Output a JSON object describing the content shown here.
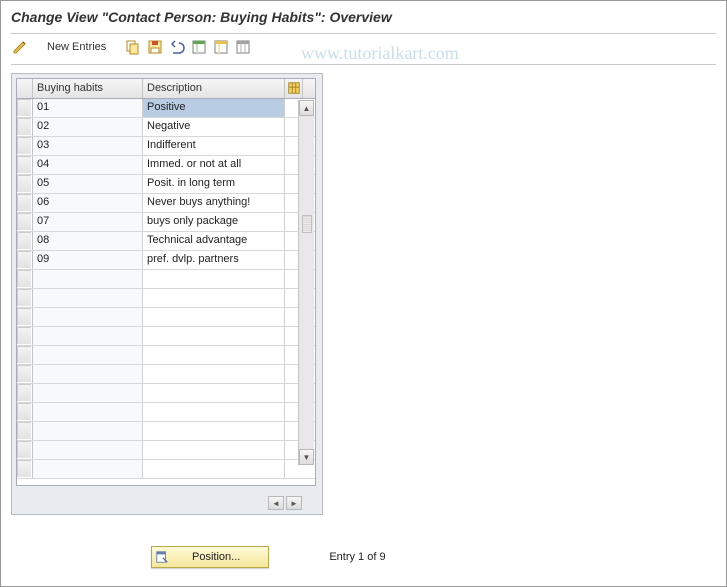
{
  "title": "Change View \"Contact Person: Buying Habits\": Overview",
  "toolbar": {
    "newEntries": "New Entries"
  },
  "watermark": "www.tutorialkart.com",
  "table": {
    "headers": {
      "code": "Buying habits",
      "desc": "Description"
    },
    "rows": [
      {
        "code": "01",
        "desc": "Positive"
      },
      {
        "code": "02",
        "desc": "Negative"
      },
      {
        "code": "03",
        "desc": "Indifferent"
      },
      {
        "code": "04",
        "desc": "Immed. or not at all"
      },
      {
        "code": "05",
        "desc": "Posit. in long term"
      },
      {
        "code": "06",
        "desc": "Never buys anything!"
      },
      {
        "code": "07",
        "desc": "buys only package"
      },
      {
        "code": "08",
        "desc": "Technical advantage"
      },
      {
        "code": "09",
        "desc": "pref. dvlp. partners"
      },
      {
        "code": "",
        "desc": ""
      },
      {
        "code": "",
        "desc": ""
      },
      {
        "code": "",
        "desc": ""
      },
      {
        "code": "",
        "desc": ""
      },
      {
        "code": "",
        "desc": ""
      },
      {
        "code": "",
        "desc": ""
      },
      {
        "code": "",
        "desc": ""
      },
      {
        "code": "",
        "desc": ""
      },
      {
        "code": "",
        "desc": ""
      },
      {
        "code": "",
        "desc": ""
      },
      {
        "code": "",
        "desc": ""
      }
    ]
  },
  "footer": {
    "positionLabel": "Position...",
    "entryText": "Entry 1 of 9"
  }
}
